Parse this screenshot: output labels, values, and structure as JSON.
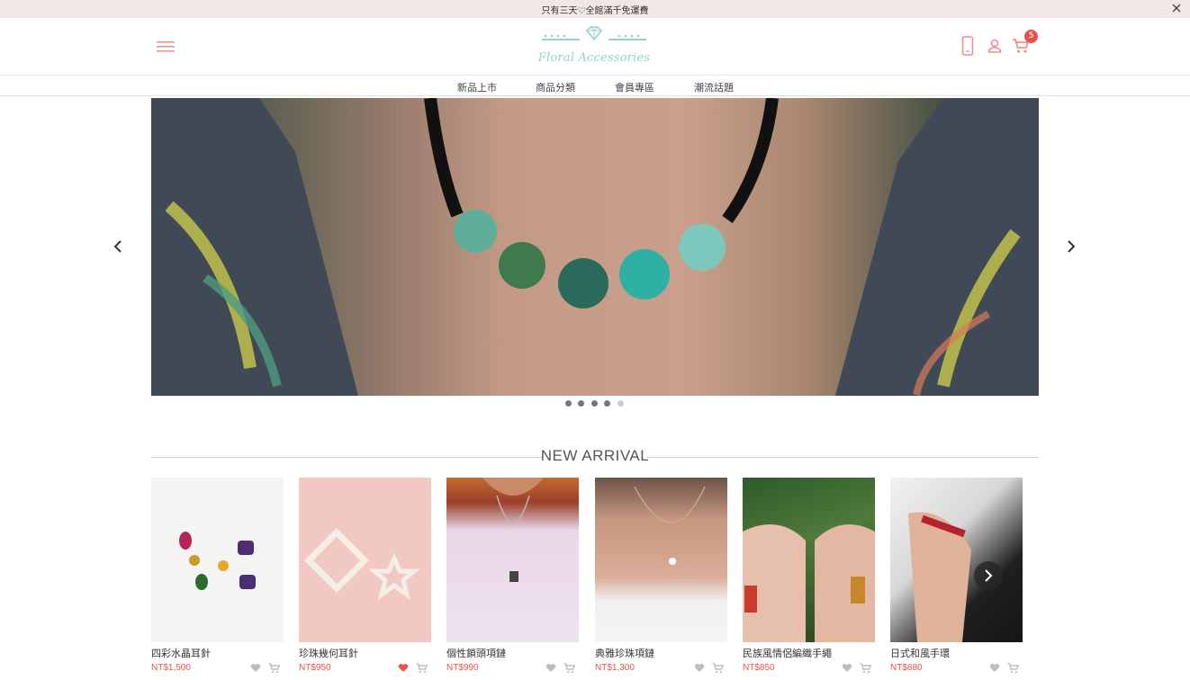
{
  "promo": {
    "text": "只有三天♡全館滿千免運費",
    "close_icon": "close-icon"
  },
  "header": {
    "logo_text": "Floral Accessories",
    "icons": [
      "menu-icon",
      "phone-icon",
      "user-icon",
      "cart-icon"
    ],
    "cart_count": "5"
  },
  "nav": {
    "items": [
      "新品上市",
      "商品分類",
      "會員專區",
      "潮流話題"
    ]
  },
  "carousel": {
    "slide_count": 5,
    "active_index": 4,
    "prev_icon": "chevron-left-icon",
    "next_icon": "chevron-right-icon"
  },
  "section": {
    "title": "NEW ARRIVAL"
  },
  "products": [
    {
      "name": "四彩水晶耳針",
      "price": "NT$1,500",
      "liked": false
    },
    {
      "name": "珍珠幾何耳針",
      "price": "NT$950",
      "liked": true
    },
    {
      "name": "個性鎖頭項鏈",
      "price": "NT$990",
      "liked": false
    },
    {
      "name": "典雅珍珠項鏈",
      "price": "NT$1,300",
      "liked": false
    },
    {
      "name": "民族風情侶編織手繩",
      "price": "NT$850",
      "liked": false
    },
    {
      "name": "日式和風手環",
      "price": "NT$880",
      "liked": false
    }
  ],
  "colors": {
    "accent": "#e5534b",
    "brand": "#8fd3cb",
    "promo_bg": "#f3e6e7",
    "icon": "#e8938d"
  }
}
